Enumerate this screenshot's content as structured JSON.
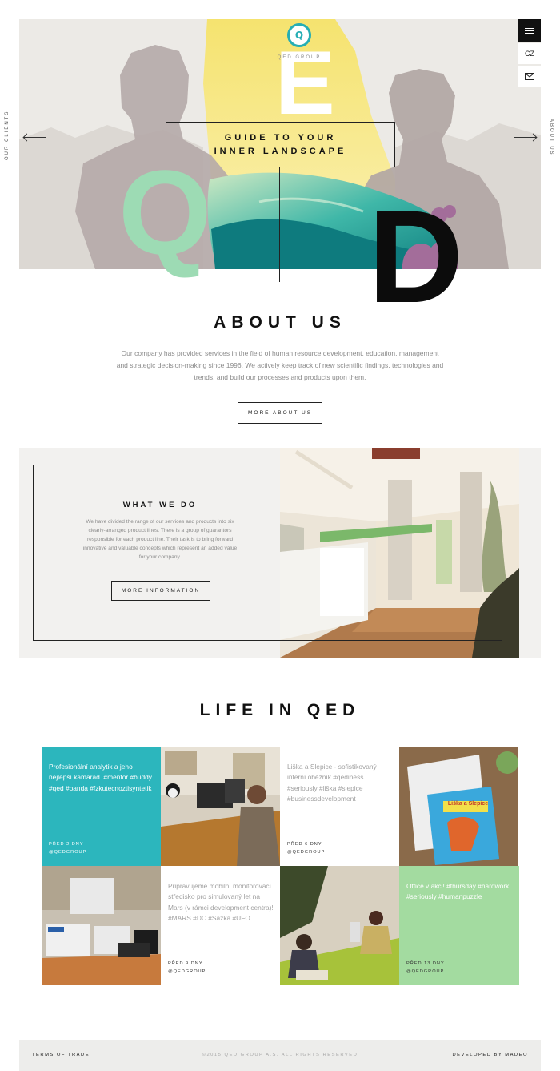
{
  "hero": {
    "logo_brand": "QED GROUP",
    "logo_glyph": "Q",
    "letters": {
      "e": "E",
      "q": "Q",
      "d": "D"
    },
    "tagline_line1": "GUIDE TO YOUR",
    "tagline_line2": "INNER LANDSCAPE",
    "left_nav_label": "OUR CLIENTS",
    "right_nav_label": "ABOUT US"
  },
  "side_menu": {
    "menu_icon": "hamburger-icon",
    "language": "CZ",
    "mail_icon": "envelope-icon"
  },
  "about": {
    "title": "ABOUT US",
    "text": "Our company has provided services in the field of human resource development, education, management and strategic decision-making since 1996. We actively keep track of new scientific findings, technologies and trends, and build our processes and products upon them.",
    "button": "MORE ABOUT US"
  },
  "what_we_do": {
    "title": "WHAT WE DO",
    "text": "We have divided the range of our services and products into six clearly-arranged product lines. There is a group of guarantors responsible for each product line. Their task is to bring forward innovative and valuable concepts which represent an added value for your company.",
    "button": "MORE INFORMATION"
  },
  "life": {
    "title": "LIFE IN QED",
    "posts": [
      {
        "text": "Profesionální analytik a jeho nejlepší kamarád. #mentor #buddy #qed #panda #fzkutecnoztisyntetik",
        "date": "PŘED 2 DNY",
        "handle": "@QEDGROUP"
      },
      {
        "text": "Liška a Slepice - sofistikovaný interní oběžník #qediness #seriously #liška #slepice #businessdevelopment",
        "date": "PŘED 6 DNY",
        "handle": "@QEDGROUP"
      },
      {
        "text": "Připravujeme mobilní monitorovací středisko pro simulovaný let na Mars (v rámci development centra)! #MARS #DC #Sazka #UFO",
        "date": "PŘED 9 DNY",
        "handle": "@QEDGROUP"
      },
      {
        "text": "Office v akci! #thursday #hardwork #seriously #humanpuzzle",
        "date": "PŘED 13 DNY",
        "handle": "@QEDGROUP"
      }
    ],
    "poster_title": "Liška a Slepice"
  },
  "footer": {
    "terms": "TERMS OF TRADE",
    "copyright": "©2015 QED GROUP A.S. ALL RIGHTS RESERVED",
    "developer": "DEVELOPED BY MADEO"
  },
  "colors": {
    "accent_teal": "#2cb6bd",
    "mint": "#9ddbb4",
    "green_tile": "#a3dba0",
    "dark": "#111111"
  }
}
